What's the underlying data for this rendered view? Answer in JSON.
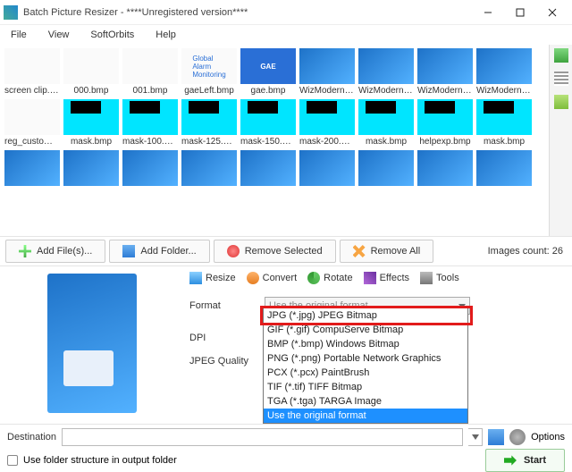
{
  "window": {
    "title": "Batch Picture Resizer - ****Unregistered version****"
  },
  "menu": {
    "file": "File",
    "view": "View",
    "softorbits": "SoftOrbits",
    "help": "Help"
  },
  "thumbs_row1": [
    {
      "label": "screen clip.bmp",
      "cls": "light"
    },
    {
      "label": "000.bmp",
      "cls": "light"
    },
    {
      "label": "001.bmp",
      "cls": "light"
    },
    {
      "label": "gaeLeft.bmp",
      "cls": "light",
      "txt": "Global\nAlarm\nMonitoring"
    },
    {
      "label": "gae.bmp",
      "cls": "logo",
      "txt": "GAE"
    },
    {
      "label": "WizModernIma...",
      "cls": "blue"
    },
    {
      "label": "WizModernIma...",
      "cls": "blue"
    },
    {
      "label": "WizModernSm...",
      "cls": "blue"
    },
    {
      "label": "WizModernSm...",
      "cls": "blue"
    }
  ],
  "thumbs_row2": [
    {
      "label": "reg_custom_ba...",
      "cls": "light"
    },
    {
      "label": "mask.bmp",
      "cls": "cyan"
    },
    {
      "label": "mask-100.bmp",
      "cls": "cyan"
    },
    {
      "label": "mask-125.bmp",
      "cls": "cyan"
    },
    {
      "label": "mask-150.bmp",
      "cls": "cyan"
    },
    {
      "label": "mask-200.bmp",
      "cls": "cyan"
    },
    {
      "label": "mask.bmp",
      "cls": "cyan"
    },
    {
      "label": "helpexp.bmp",
      "cls": "cyan"
    },
    {
      "label": "mask.bmp",
      "cls": "cyan"
    }
  ],
  "thumbs_row3": [
    {
      "label": "",
      "cls": "blue"
    },
    {
      "label": "",
      "cls": "blue"
    },
    {
      "label": "",
      "cls": "blue"
    },
    {
      "label": "",
      "cls": "blue"
    },
    {
      "label": "",
      "cls": "blue"
    },
    {
      "label": "",
      "cls": "blue"
    },
    {
      "label": "",
      "cls": "blue"
    },
    {
      "label": "",
      "cls": "blue"
    },
    {
      "label": "",
      "cls": "blue"
    }
  ],
  "buttons": {
    "add_files": "Add File(s)...",
    "add_folder": "Add Folder...",
    "remove_selected": "Remove Selected",
    "remove_all": "Remove All"
  },
  "images_count": "Images count: 26",
  "tabs": {
    "resize": "Resize",
    "convert": "Convert",
    "rotate": "Rotate",
    "effects": "Effects",
    "tools": "Tools"
  },
  "form": {
    "format": "Format",
    "format_value": "Use the original format",
    "dpi": "DPI",
    "jpeg_quality": "JPEG Quality"
  },
  "format_options": [
    "JPG (*.jpg) JPEG Bitmap",
    "GIF (*.gif) CompuServe Bitmap",
    "BMP (*.bmp) Windows Bitmap",
    "PNG (*.png) Portable Network Graphics",
    "PCX (*.pcx) PaintBrush",
    "TIF (*.tif) TIFF Bitmap",
    "TGA (*.tga) TARGA Image",
    "Use the original format"
  ],
  "format_selected_index": 7,
  "destination_label": "Destination",
  "options_label": "Options",
  "use_folder_structure": "Use folder structure in output folder",
  "start": "Start"
}
